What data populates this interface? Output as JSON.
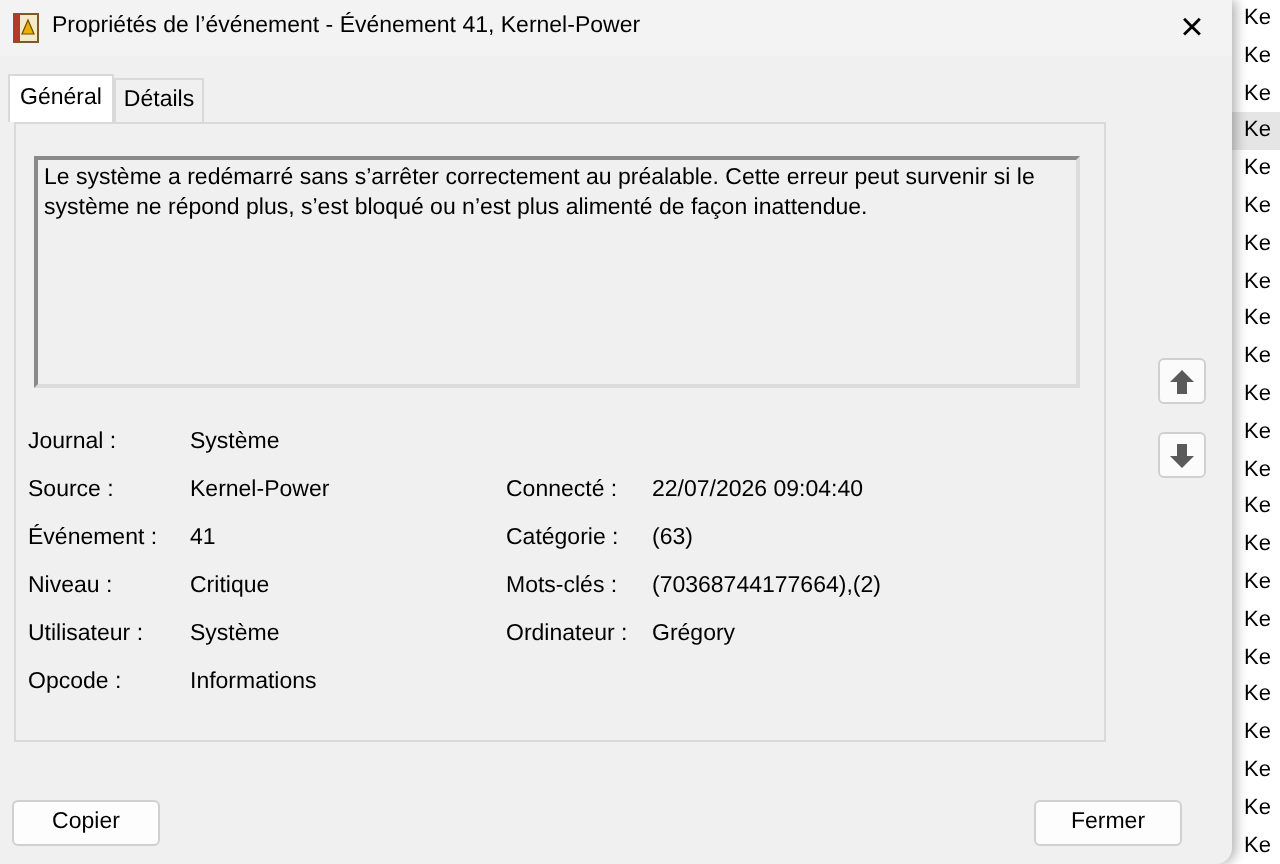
{
  "window": {
    "title": "Propriétés de l’événement - Événement 41, Kernel-Power",
    "close": "×"
  },
  "tabs": [
    {
      "label": "Général",
      "selected": true
    },
    {
      "label": "Détails",
      "selected": false
    }
  ],
  "description": "Le système a redémarré sans s’arrêter correctement au préalable. Cette erreur peut survenir si le système ne répond plus, s’est bloqué ou n’est plus alimenté de façon inattendue.",
  "fields": [
    {
      "left": {
        "label": "Journal :",
        "value": "Système"
      }
    },
    {
      "left": {
        "label": "Source :",
        "value": "Kernel-Power"
      },
      "right": {
        "label": "Connecté :",
        "value": "22/07/2026 09:04:40"
      }
    },
    {
      "left": {
        "label": "Événement :",
        "value": "41"
      },
      "right": {
        "label": "Catégorie :",
        "value": "(63)"
      }
    },
    {
      "left": {
        "label": "Niveau :",
        "value": "Critique"
      },
      "right": {
        "label": "Mots-clés :",
        "value": "(70368744177664),(2)"
      }
    },
    {
      "left": {
        "label": "Utilisateur :",
        "value": "Système"
      },
      "right": {
        "label": "Ordinateur :",
        "value": "Grégory"
      }
    },
    {
      "left": {
        "label": "Opcode :",
        "value": "Informations"
      }
    }
  ],
  "buttons": [
    {
      "label": "Copier"
    },
    {
      "label": "Fermer"
    }
  ],
  "background_list": [
    {
      "text": "Ke",
      "selected": false
    },
    {
      "text": "Ke",
      "selected": false
    },
    {
      "text": "Ke",
      "selected": false
    },
    {
      "text": "Ke",
      "selected": true
    },
    {
      "text": "Ke",
      "selected": false
    },
    {
      "text": "Ke",
      "selected": false
    },
    {
      "text": "Ke",
      "selected": false
    },
    {
      "text": "Ke",
      "selected": false
    },
    {
      "text": "Ke",
      "selected": false
    },
    {
      "text": "Ke",
      "selected": false
    },
    {
      "text": "Ke",
      "selected": false
    },
    {
      "text": "Ke",
      "selected": false
    },
    {
      "text": "Ke",
      "selected": false
    },
    {
      "text": "Ke",
      "selected": false
    },
    {
      "text": "Ke",
      "selected": false
    },
    {
      "text": "Ke",
      "selected": false
    },
    {
      "text": "Ke",
      "selected": false
    },
    {
      "text": "Ke",
      "selected": false
    },
    {
      "text": "Ke",
      "selected": false
    },
    {
      "text": "Ke",
      "selected": false
    },
    {
      "text": "Ke",
      "selected": false
    },
    {
      "text": "Ke",
      "selected": false
    },
    {
      "text": "Ke",
      "selected": false
    }
  ]
}
